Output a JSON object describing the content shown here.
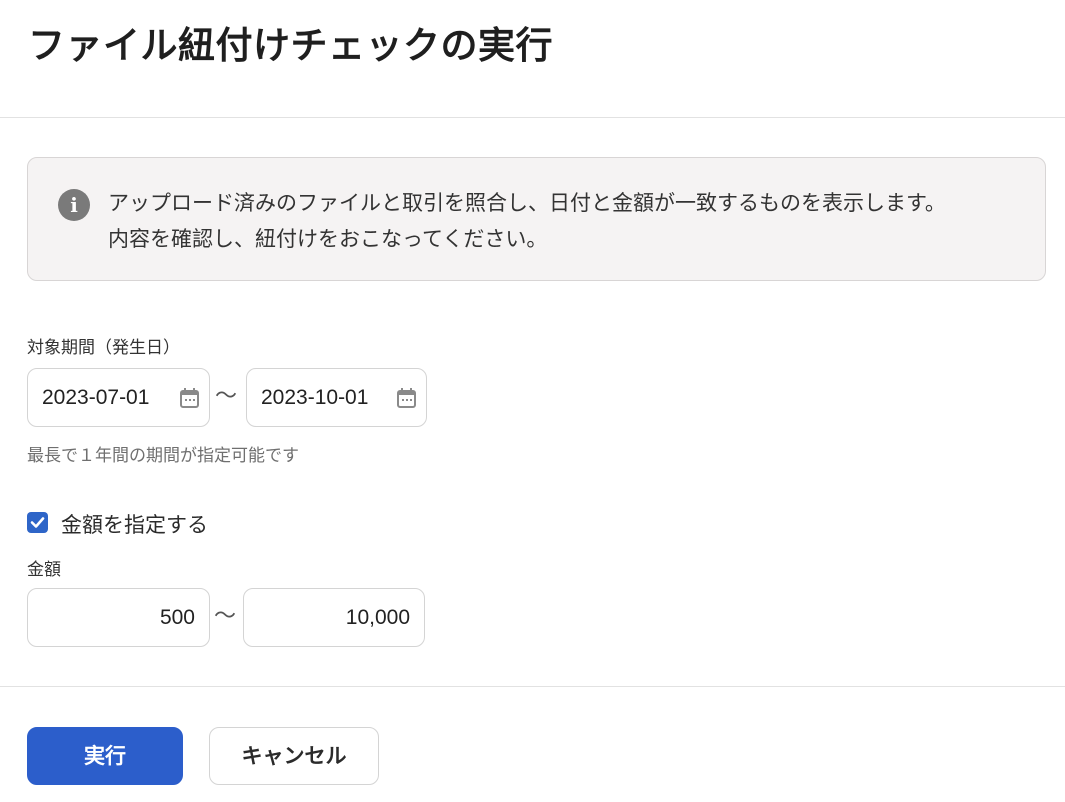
{
  "page": {
    "title": "ファイル紐付けチェックの実行"
  },
  "info": {
    "icon": "info-icon",
    "line1": "アップロード済みのファイルと取引を照合し、日付と金額が一致するものを表示します。",
    "line2": "内容を確認し、紐付けをおこなってください。"
  },
  "period": {
    "label": "対象期間（発生日）",
    "from": "2023-07-01",
    "to": "2023-10-01",
    "separator": "〜",
    "hint": "最長で１年間の期間が指定可能です",
    "icon": "calendar-icon"
  },
  "amount_toggle": {
    "checked": true,
    "label": "金額を指定する"
  },
  "amount": {
    "label": "金額",
    "from": "500",
    "to": "10,000",
    "separator": "〜"
  },
  "actions": {
    "run_label": "実行",
    "cancel_label": "キャンセル"
  },
  "colors": {
    "primary": "#2c5ecb",
    "info_bg": "#f5f3f3"
  }
}
